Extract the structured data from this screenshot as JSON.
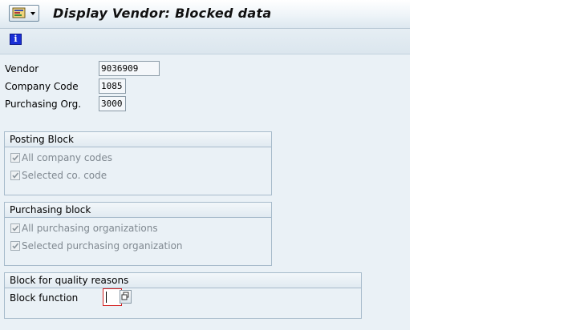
{
  "header": {
    "title": "Display Vendor: Blocked data",
    "menu_icon": "system-menu-icon"
  },
  "toolbar": {
    "info_icon": "information-icon",
    "info_glyph": "i"
  },
  "fields": {
    "vendor": {
      "label": "Vendor",
      "value": "9036909"
    },
    "company_code": {
      "label": "Company Code",
      "value": "1085"
    },
    "purchasing_org": {
      "label": "Purchasing Org.",
      "value": "3000"
    }
  },
  "posting_block": {
    "title": "Posting Block",
    "all_company_codes": {
      "label": "All company codes",
      "checked": true
    },
    "selected_co_code": {
      "label": "Selected co. code",
      "checked": true
    }
  },
  "purchasing_block": {
    "title": "Purchasing block",
    "all_purchasing_orgs": {
      "label": "All purchasing organizations",
      "checked": true
    },
    "selected_purchasing_org": {
      "label": "Selected purchasing organization",
      "checked": true
    }
  },
  "quality_block": {
    "title": "Block for quality reasons",
    "block_function": {
      "label": "Block function",
      "value": ""
    }
  },
  "colors": {
    "background": "#eaf1f6",
    "focus_border": "#d42020",
    "info_icon": "#1a2fd6"
  }
}
